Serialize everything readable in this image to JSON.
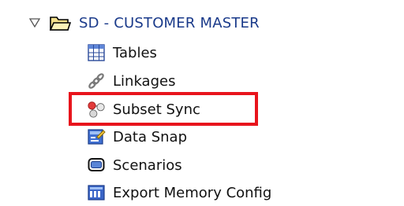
{
  "tree": {
    "root": {
      "label": "SD - CUSTOMER MASTER",
      "expander_icon": "triangle-down-icon",
      "folder_icon": "open-folder-icon"
    },
    "items": [
      {
        "label": "Tables",
        "icon": "table-grid-icon"
      },
      {
        "label": "Linkages",
        "icon": "chain-link-icon"
      },
      {
        "label": "Subset Sync",
        "icon": "molecule-icon"
      },
      {
        "label": "Data Snap",
        "icon": "data-snap-icon"
      },
      {
        "label": "Scenarios",
        "icon": "scenario-screen-icon"
      },
      {
        "label": "Export Memory Config",
        "icon": "memory-config-icon"
      }
    ],
    "highlighted_item": "Subset Sync"
  },
  "colors": {
    "root_text": "#1a3a8a",
    "item_text": "#111111",
    "highlight_border": "#e8141c"
  }
}
